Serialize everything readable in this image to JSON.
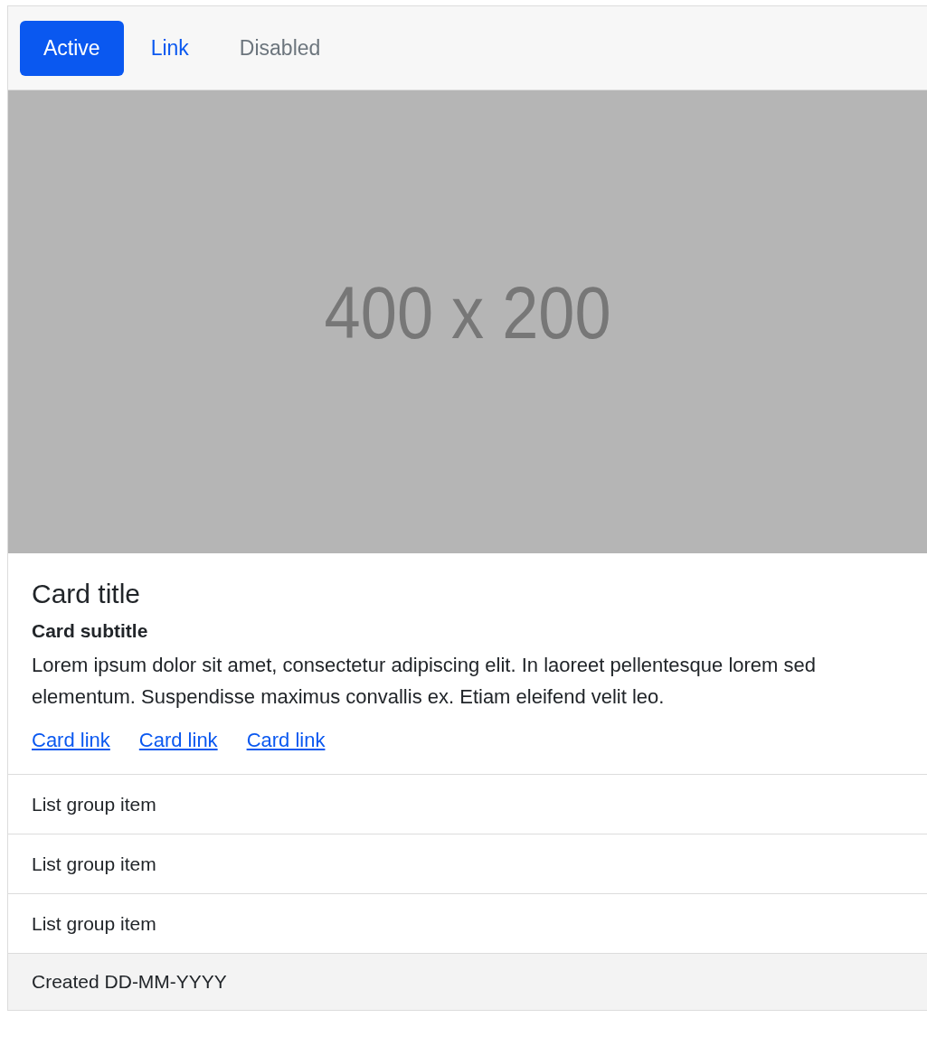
{
  "tabs": [
    {
      "label": "Active",
      "selected": true,
      "disabled": false
    },
    {
      "label": "Link",
      "selected": false,
      "disabled": false
    },
    {
      "label": "Disabled",
      "selected": false,
      "disabled": true
    }
  ],
  "image": {
    "label": "400 x 200"
  },
  "card": {
    "title": "Card title",
    "subtitle": "Card subtitle",
    "text": "Lorem ipsum dolor sit amet, consectetur adipiscing elit. In laoreet pellentesque lorem sed elementum. Suspendisse maximus convallis ex. Etiam eleifend velit leo.",
    "links": [
      "Card link",
      "Card link",
      "Card link"
    ]
  },
  "list_items": [
    "List group item",
    "List group item",
    "List group item"
  ],
  "footer": "Created DD-MM-YYYY"
}
